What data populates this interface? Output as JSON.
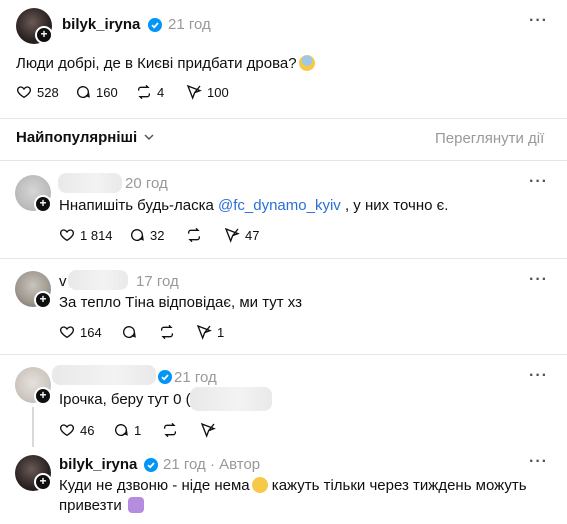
{
  "main_post": {
    "username": "bilyk_iryna",
    "time": "21 год",
    "text": "Люди добрі, де в Києві придбати дрова?",
    "likes": "528",
    "replies": "160",
    "reposts": "4",
    "shares": "100"
  },
  "sort_bar": {
    "label": "Найпопулярніші",
    "view_activity": "Переглянути дії"
  },
  "replies": [
    {
      "time": "20 год",
      "text_before": "Ннапишіть будь-ласка ",
      "mention": "@fc_dynamo_kyiv",
      "text_after": " , у них точно є.",
      "likes": "1 814",
      "replies": "32",
      "shares": "47"
    },
    {
      "username_prefix": "v",
      "time": "17 год",
      "text": "За тепло Тіна відповідає, ми тут хз",
      "likes": "164",
      "shares": "1"
    },
    {
      "time": "21 год",
      "text": "Ірочка, беру тут 0 (6",
      "likes": "46",
      "replies": "1"
    },
    {
      "username": "bilyk_iryna",
      "time": "21 год",
      "author_sep": "·",
      "author_label": "Автор",
      "text_line1": "Куди не дзвоню - ніде нема",
      "text_line1b": " кажуть тільки через тиждень можуть",
      "text_line2": "привезти"
    }
  ],
  "colors": {
    "accent_link": "#2a6fd6",
    "verified": "#0095f6",
    "muted": "#999999"
  }
}
